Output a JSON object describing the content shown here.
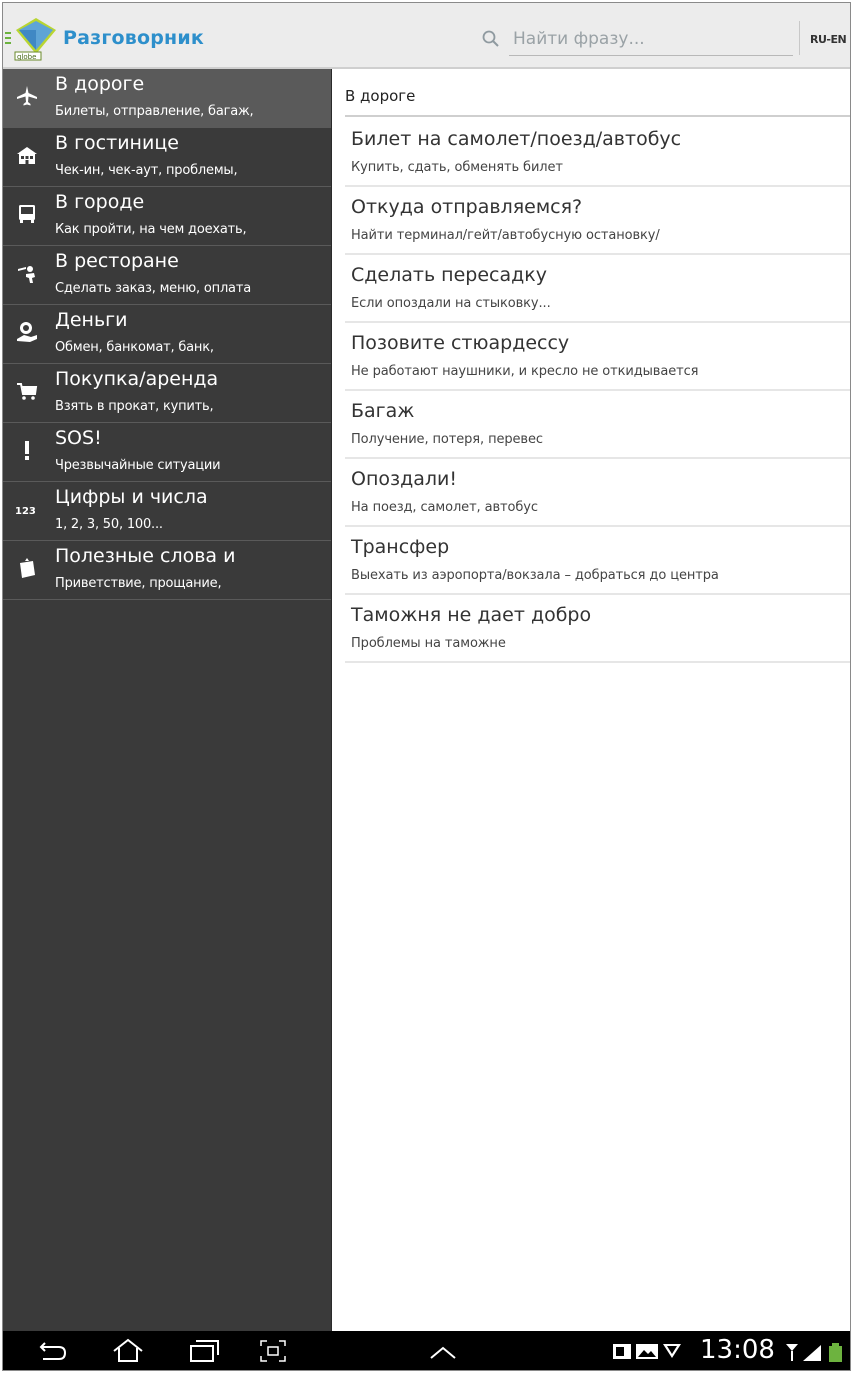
{
  "app": {
    "title": "Разговорник",
    "language": "RU-EN"
  },
  "search": {
    "placeholder": "Найти фразу..."
  },
  "sidebar": {
    "items": [
      {
        "icon": "airplane-icon",
        "title": "В дороге",
        "subtitle": "Билеты, отправление, багаж,",
        "active": true
      },
      {
        "icon": "hotel-icon",
        "title": "В гостинице",
        "subtitle": "Чек-ин, чек-аут, проблемы,",
        "active": false
      },
      {
        "icon": "bus-icon",
        "title": "В городе",
        "subtitle": "Как пройти, на чем доехать,",
        "active": false
      },
      {
        "icon": "waiter-icon",
        "title": "В ресторане",
        "subtitle": "Сделать заказ, меню, оплата",
        "active": false
      },
      {
        "icon": "money-icon",
        "title": "Деньги",
        "subtitle": "Обмен, банкомат, банк,",
        "active": false
      },
      {
        "icon": "cart-icon",
        "title": "Покупка/аренда",
        "subtitle": "Взять в прокат, купить,",
        "active": false
      },
      {
        "icon": "exclamation-icon",
        "title": "SOS!",
        "subtitle": "Чрезвычайные ситуации",
        "active": false
      },
      {
        "icon": "numbers-icon",
        "title": "Цифры и числа",
        "subtitle": "1, 2, 3, 50, 100...",
        "active": false
      },
      {
        "icon": "book-icon",
        "title": "Полезные слова и",
        "subtitle": "Приветствие, прощание,",
        "active": false
      }
    ],
    "numbers_icon_text": "123"
  },
  "content": {
    "header": "В дороге",
    "items": [
      {
        "title": "Билет на самолет/поезд/автобус",
        "subtitle": "Купить, сдать, обменять билет"
      },
      {
        "title": "Откуда отправляемся?",
        "subtitle": "Найти терминал/гейт/автобусную остановку/"
      },
      {
        "title": "Сделать пересадку",
        "subtitle": "Если опоздали на стыковку..."
      },
      {
        "title": "Позовите стюардессу",
        "subtitle": "Не работают наушники, и кресло не откидывается"
      },
      {
        "title": "Багаж",
        "subtitle": "Получение, потеря, перевес"
      },
      {
        "title": "Опоздали!",
        "subtitle": "На поезд, самолет, автобус"
      },
      {
        "title": "Трансфер",
        "subtitle": "Выехать из аэропорта/вокзала – добраться до центра"
      },
      {
        "title": "Таможня не дает добро",
        "subtitle": "Проблемы на таможне"
      }
    ]
  },
  "statusbar": {
    "time": "13:08"
  },
  "colors": {
    "brand": "#2d8fcb",
    "accent_green": "#6db33f",
    "sidebar_bg": "#3a3a3a",
    "sidebar_active": "#5a5a5a"
  }
}
